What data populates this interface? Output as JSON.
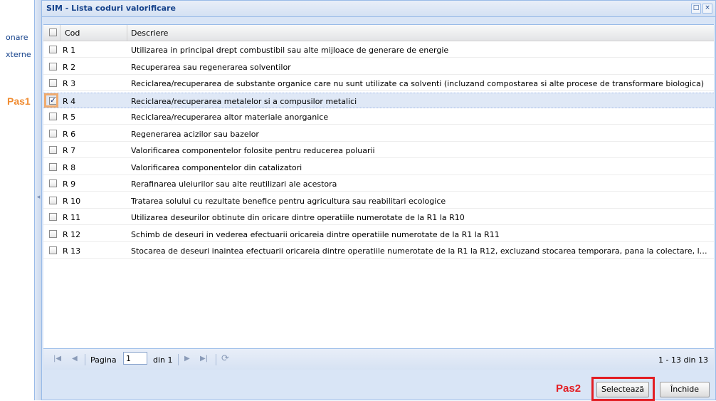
{
  "left_nav": [
    "onare",
    "xterne"
  ],
  "window": {
    "title": "SIM - Lista coduri valorificare",
    "tools": [
      "□",
      "×"
    ]
  },
  "grid": {
    "columns": [
      "Cod",
      "Descriere"
    ],
    "rows": [
      {
        "cod": "R 1",
        "desc": "Utilizarea in principal drept combustibil sau alte mijloace de generare de energie",
        "checked": false
      },
      {
        "cod": "R 2",
        "desc": "Recuperarea sau regenerarea solventilor",
        "checked": false
      },
      {
        "cod": "R 3",
        "desc": "Reciclarea/recuperarea de substante organice care nu sunt utilizate ca solventi (incluzand compostarea si alte procese de transformare biologica)",
        "checked": false
      },
      {
        "cod": "R 4",
        "desc": "Reciclarea/recuperarea metalelor si a compusilor metalici",
        "checked": true
      },
      {
        "cod": "R 5",
        "desc": "Reciclarea/recuperarea altor materiale anorganice",
        "checked": false
      },
      {
        "cod": "R 6",
        "desc": "Regenerarea acizilor sau bazelor",
        "checked": false
      },
      {
        "cod": "R 7",
        "desc": "Valorificarea componentelor folosite pentru reducerea poluarii",
        "checked": false
      },
      {
        "cod": "R 8",
        "desc": "Valorificarea componentelor din catalizatori",
        "checked": false
      },
      {
        "cod": "R 9",
        "desc": "Rerafinarea uleiurilor sau alte reutilizari ale acestora",
        "checked": false
      },
      {
        "cod": "R 10",
        "desc": "Tratarea solului cu rezultate benefice pentru agricultura sau reabilitari ecologice",
        "checked": false
      },
      {
        "cod": "R 11",
        "desc": "Utilizarea deseurilor obtinute din oricare dintre operatiile numerotate de la R1 la R10",
        "checked": false
      },
      {
        "cod": "R 12",
        "desc": "Schimb de deseuri in vederea efectuarii oricareia dintre operatiile numerotate de la R1 la R11",
        "checked": false
      },
      {
        "cod": "R 13",
        "desc": "Stocarea de deseuri inaintea efectuarii oricareia dintre operatiile numerotate de la R1 la R12, excluzand stocarea temporara, pana la colectare, la locul de pr...",
        "checked": false
      }
    ]
  },
  "pager": {
    "page_label": "Pagina",
    "page_value": "1",
    "of_label": "din 1",
    "count_label": "1 - 13 din 13"
  },
  "buttons": {
    "select": "Selectează",
    "close": "Închide"
  },
  "annotations": {
    "step1": "Pas1",
    "step2": "Pas2",
    "step1_color": "#f08c32",
    "step2_color": "#e31e24"
  }
}
